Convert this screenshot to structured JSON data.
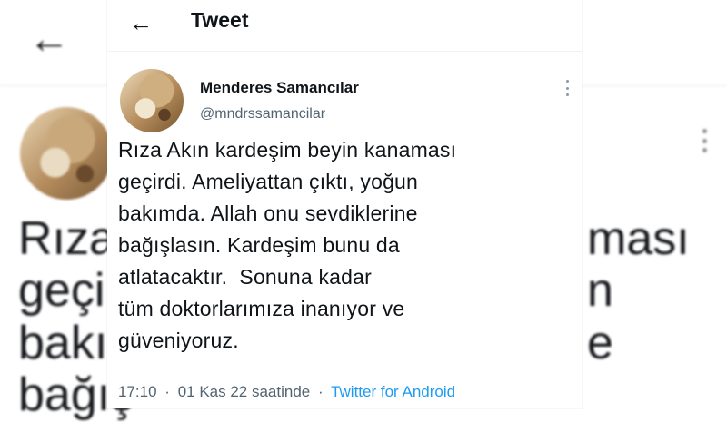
{
  "background": {
    "back_glyph": "←",
    "text_left": [
      "Rıza",
      "geçi",
      "bakı",
      "bağış"
    ],
    "text_right": [
      "ması",
      "n",
      "e"
    ]
  },
  "header": {
    "back_icon": "arrow-left-icon",
    "back_glyph": "←",
    "title": "Tweet"
  },
  "tweet": {
    "author_name": "Menderes Samancılar",
    "author_handle": "@mndrssamancilar",
    "lines": [
      "Rıza Akın kardeşim beyin kanaması",
      "geçirdi. Ameliyattan çıktı, yoğun",
      "bakımda. Allah onu sevdiklerine",
      "bağışlasın. Kardeşim bunu da",
      "atlatacaktır.  Sonuna kadar",
      "tüm doktorlarımıza inanıyor ve",
      "güveniyoruz."
    ],
    "time": "17:10",
    "separator": "·",
    "date": "01 Kas 22 saatinde",
    "source": "Twitter for Android"
  },
  "colors": {
    "text": "#0f1419",
    "secondary": "#536471",
    "link": "#1d9bf0"
  }
}
